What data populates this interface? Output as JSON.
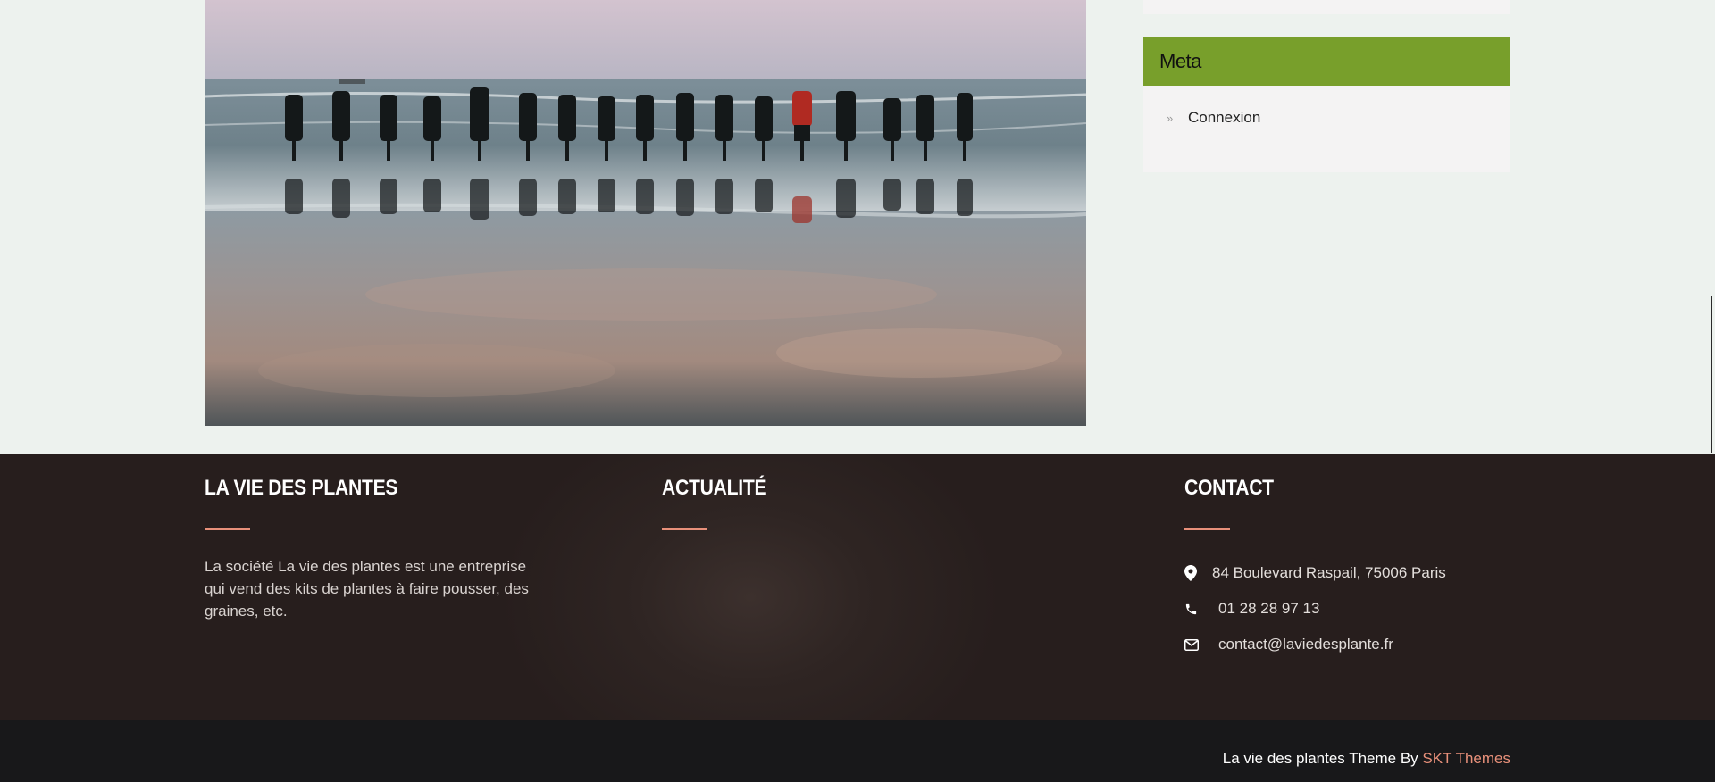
{
  "post": {
    "image_alt": "Group of people holding hands at the beach"
  },
  "sidebar": {
    "meta_widget": {
      "title": "Meta",
      "items": [
        {
          "label": "Connexion"
        }
      ]
    }
  },
  "footer": {
    "about": {
      "title": "LA VIE DES PLANTES",
      "text": "La société La vie des plantes est une entreprise qui vend des kits de plantes à faire pousser, des graines, etc."
    },
    "news": {
      "title": "ACTUALITÉ"
    },
    "contact": {
      "title": "CONTACT",
      "address": "84 Boulevard Raspail, 75006 Paris",
      "phone": "01 28 28 97 13",
      "email": "contact@laviedesplante.fr"
    },
    "credits": {
      "prefix": "La vie des plantes Theme By ",
      "link": "SKT Themes"
    }
  },
  "colors": {
    "page_bg": "#edf2ee",
    "widget_header": "#789f2b",
    "accent": "#e8907a",
    "footer_bg": "#271e1d",
    "footer_bottom_bg": "#18181a"
  }
}
